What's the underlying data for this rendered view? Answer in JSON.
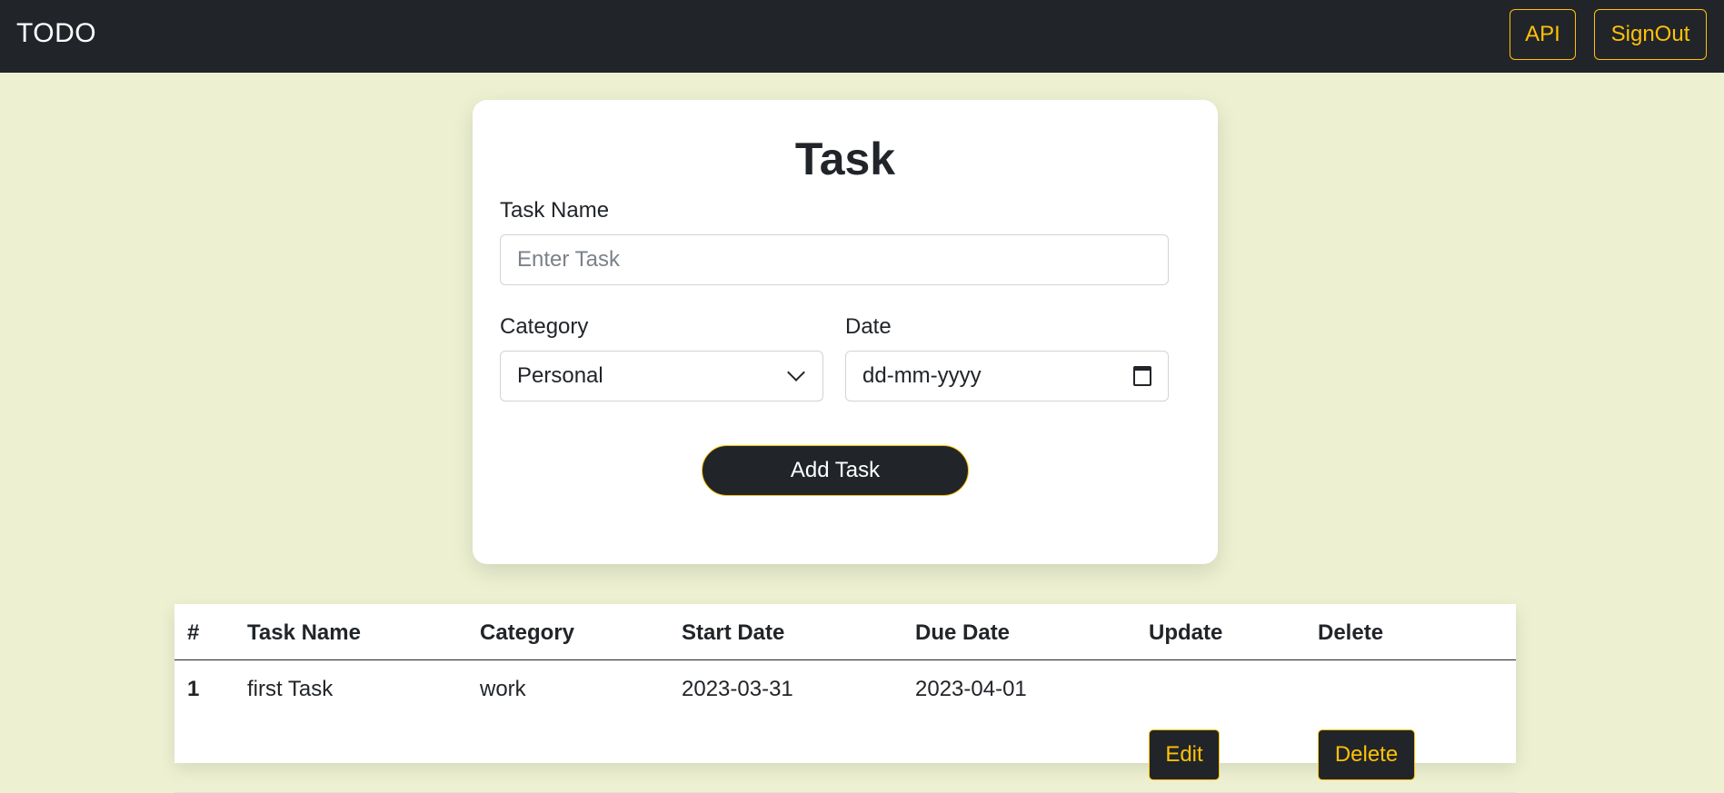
{
  "navbar": {
    "brand": "TODO",
    "api_label": "API",
    "signout_label": "SignOut"
  },
  "form": {
    "title": "Task",
    "task_name_label": "Task Name",
    "task_name_placeholder": "Enter Task",
    "task_name_value": "",
    "category_label": "Category",
    "category_value": "Personal",
    "date_label": "Date",
    "date_value": "dd-mm-yyyy",
    "add_button_label": "Add Task"
  },
  "table": {
    "headers": [
      "#",
      "Task Name",
      "Category",
      "Start Date",
      "Due Date",
      "Update",
      "Delete"
    ],
    "rows": [
      {
        "index": "1",
        "task_name": "first Task",
        "category": "work",
        "start_date": "2023-03-31",
        "due_date": "2023-04-01",
        "edit_label": "Edit",
        "delete_label": "Delete"
      }
    ]
  },
  "colors": {
    "navbar_bg": "#212529",
    "accent": "#ffc107",
    "page_bg": "#edf1d1"
  },
  "icons": {
    "category_select": "chevron-down-icon",
    "date_picker": "calendar-icon"
  }
}
